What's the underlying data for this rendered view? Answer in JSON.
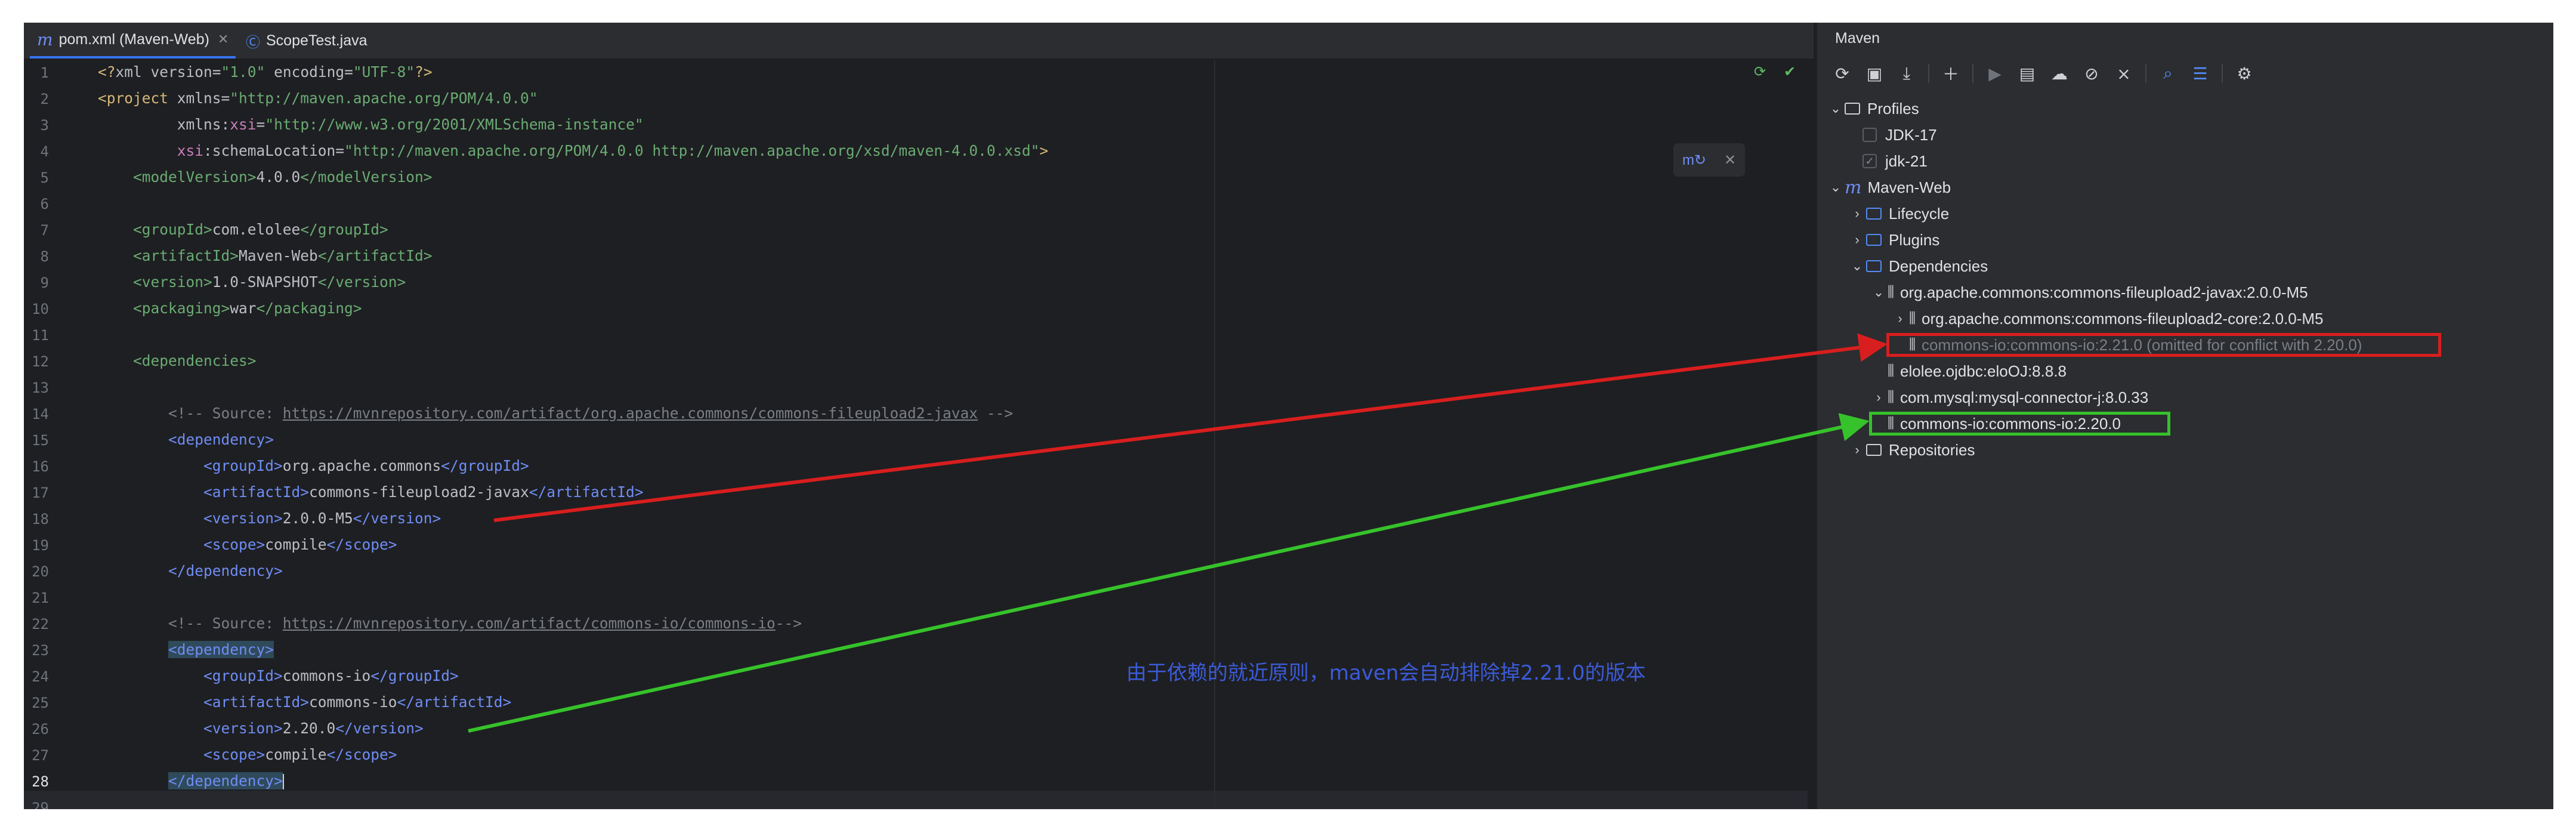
{
  "tabs": [
    {
      "label": "pom.xml (Maven-Web)",
      "active": true
    },
    {
      "label": "ScopeTest.java",
      "active": false
    }
  ],
  "editor": {
    "lines": [
      "1",
      "2",
      "3",
      "4",
      "5",
      "6",
      "7",
      "8",
      "9",
      "10",
      "11",
      "12",
      "13",
      "14",
      "15",
      "16",
      "17",
      "18",
      "19",
      "20",
      "21",
      "22",
      "23",
      "24",
      "25",
      "26",
      "27",
      "28",
      "29"
    ],
    "current_line": "28",
    "xml_decl": {
      "version": "1.0",
      "encoding": "UTF-8"
    },
    "project_ns": "http://maven.apache.org/POM/4.0.0",
    "xsi_ns": "http://www.w3.org/2001/XMLSchema-instance",
    "schema_location": "http://maven.apache.org/POM/4.0.0 http://maven.apache.org/xsd/maven-4.0.0.xsd",
    "model_version": "4.0.0",
    "group_id": "com.elolee",
    "artifact_id": "Maven-Web",
    "version": "1.0-SNAPSHOT",
    "packaging": "war",
    "comment1_prefix": "<!-- Source: ",
    "comment1_url": "https://mvnrepository.com/artifact/org.apache.commons/commons-fileupload2-javax",
    "comment1_suffix": " -->",
    "dep1": {
      "groupId": "org.apache.commons",
      "artifactId": "commons-fileupload2-javax",
      "version": "2.0.0-M5",
      "scope": "compile"
    },
    "comment2_prefix": "<!-- Source: ",
    "comment2_url": "https://mvnrepository.com/artifact/commons-io/commons-io",
    "comment2_suffix": "-->",
    "dep2": {
      "groupId": "commons-io",
      "artifactId": "commons-io",
      "version": "2.20.0",
      "scope": "compile"
    }
  },
  "maven": {
    "title": "Maven",
    "tree": {
      "profiles": "Profiles",
      "profile_items": [
        "JDK-17",
        "jdk-21"
      ],
      "project": "Maven-Web",
      "lifecycle": "Lifecycle",
      "plugins": "Plugins",
      "dependencies": "Dependencies",
      "dep_fileupload": "org.apache.commons:commons-fileupload2-javax:2.0.0-M5",
      "dep_fileupload_core": "org.apache.commons:commons-fileupload2-core:2.0.0-M5",
      "dep_commons_io_omitted": "commons-io:commons-io:2.21.0 (omitted for conflict with 2.20.0)",
      "dep_elolee": "elolee.ojdbc:eloOJ:8.8.8",
      "dep_mysql": "com.mysql:mysql-connector-j:8.0.33",
      "dep_commons_io": "commons-io:commons-io:2.20.0",
      "repositories": "Repositories"
    }
  },
  "annotation": {
    "text": "由于依赖的就近原则，maven会自动排除掉2.21.0的版本",
    "red_color": "#d81e1e",
    "green_color": "#36c22b",
    "text_color": "#3b5bd9"
  },
  "icons": {
    "maven_file": "maven-icon",
    "java_class": "java-class-icon",
    "reload": "reload-icon",
    "folder": "folder-icon",
    "library": "library-icon"
  }
}
